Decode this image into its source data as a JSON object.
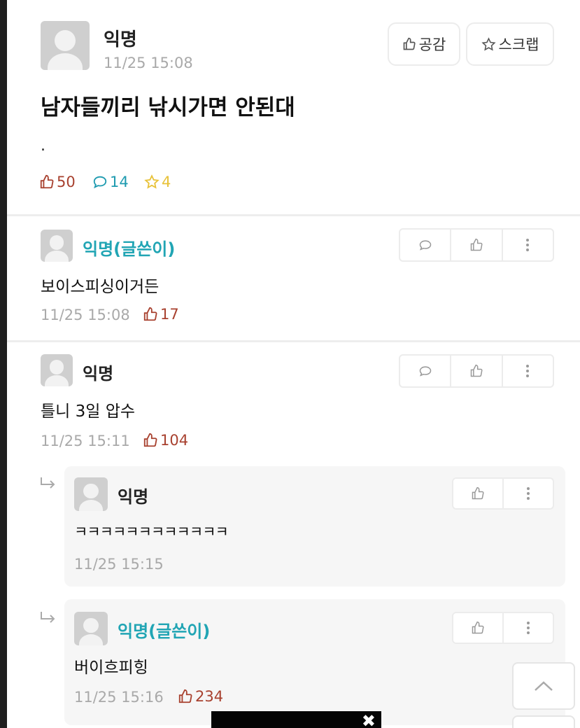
{
  "post": {
    "author": "익명",
    "timestamp": "11/25 15:08",
    "title": "남자들끼리 낚시가면 안된대",
    "body": ".",
    "like_button": "공감",
    "scrap_button": "스크랩",
    "likes": "50",
    "comments": "14",
    "scraps": "4"
  },
  "comments": [
    {
      "author": "익명(글쓴이)",
      "text": "보이스피싱이거든",
      "timestamp": "11/25 15:08",
      "likes": "17"
    },
    {
      "author": "익명",
      "text": "틀니 3일 압수",
      "timestamp": "11/25 15:11",
      "likes": "104"
    }
  ],
  "replies": [
    {
      "author": "익명",
      "text": "ㅋㅋㅋㅋㅋㅋㅋㅋㅋㅋㅋㅋ",
      "timestamp": "11/25 15:15"
    },
    {
      "author": "익명(글쓴이)",
      "text": "버이흐피힝",
      "timestamp": "11/25 15:16",
      "likes": "234"
    }
  ],
  "ad": {
    "close": "✖"
  },
  "icons": {
    "thumb_up": "thumbs-up-icon",
    "comment": "speech-bubble-icon",
    "star": "star-icon",
    "more": "more-vertical-icon",
    "reply_arrow": "reply-arrow-icon",
    "scroll_top": "chevron-up-icon"
  },
  "colors": {
    "writer_accent": "#21a5b4",
    "like": "#a8412f",
    "comment": "#1f9bb0",
    "scrap": "#e8c23a"
  }
}
